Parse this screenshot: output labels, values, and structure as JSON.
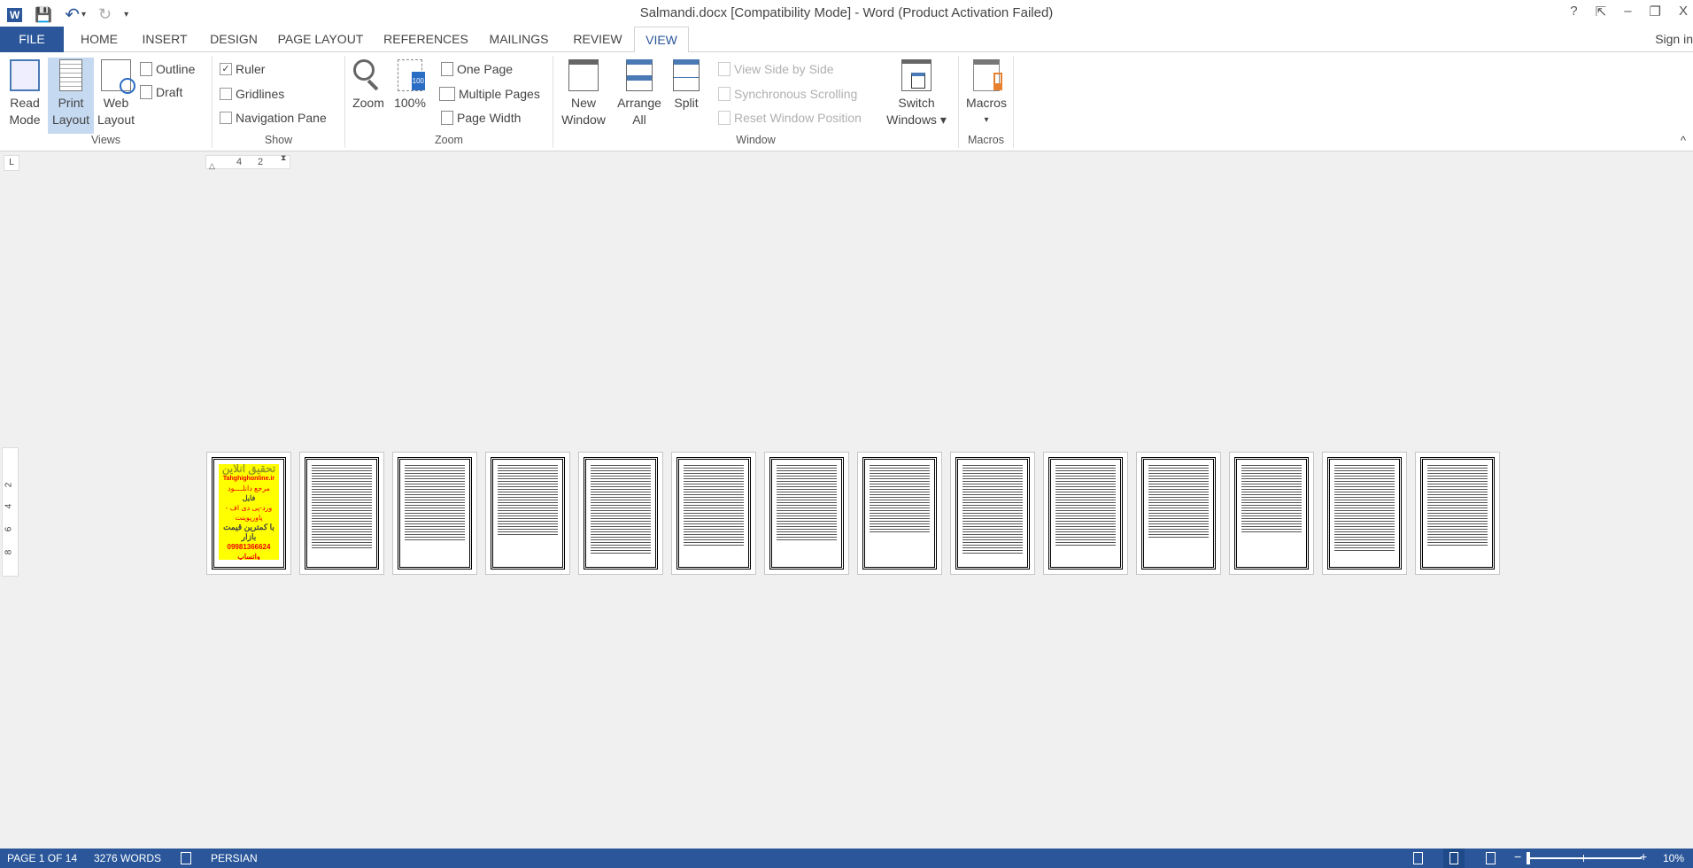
{
  "window": {
    "title": "Salmandi.docx [Compatibility Mode] - Word (Product Activation Failed)",
    "help": "?",
    "restore_ribbon": "⇱",
    "minimize": "–",
    "restore": "❐",
    "close": "X"
  },
  "qat": {
    "word": "W",
    "save": "💾",
    "undo": "↶",
    "undo_more": "▾",
    "redo": "↻",
    "customize": "▾"
  },
  "tabs": [
    "FILE",
    "HOME",
    "INSERT",
    "DESIGN",
    "PAGE LAYOUT",
    "REFERENCES",
    "MAILINGS",
    "REVIEW",
    "VIEW"
  ],
  "active_tab": "VIEW",
  "sign_in": "Sign in",
  "ribbon": {
    "views": {
      "label": "Views",
      "read_mode": [
        "Read",
        "Mode"
      ],
      "print_layout": [
        "Print",
        "Layout"
      ],
      "web_layout": [
        "Web",
        "Layout"
      ],
      "outline": "Outline",
      "draft": "Draft"
    },
    "show": {
      "label": "Show",
      "ruler": "Ruler",
      "ruler_checked": true,
      "gridlines": "Gridlines",
      "gridlines_checked": false,
      "navigation_pane": "Navigation Pane",
      "navigation_checked": false,
      "check": "✓"
    },
    "zoom": {
      "label": "Zoom",
      "zoom": "Zoom",
      "hundred": "100%",
      "hundred_badge": "100",
      "one_page": "One Page",
      "multiple_pages": "Multiple Pages",
      "page_width": "Page Width"
    },
    "window": {
      "label": "Window",
      "new_window": [
        "New",
        "Window"
      ],
      "arrange_all": [
        "Arrange",
        "All"
      ],
      "split": "Split",
      "side_by_side": "View Side by Side",
      "sync_scroll": "Synchronous Scrolling",
      "reset_position": "Reset Window Position",
      "switch_windows": [
        "Switch",
        "Windows ▾"
      ]
    },
    "macros": {
      "label": "Macros",
      "macros": "Macros",
      "arrow": "▾"
    },
    "collapse": "^"
  },
  "ruler": {
    "corner": "L",
    "marks": [
      "4",
      "2"
    ],
    "vertical": [
      "2",
      "4",
      "6",
      "8"
    ]
  },
  "cover_page": {
    "title": "تحقیق آنلاین",
    "site": "Tahghighonline.ir",
    "line1": "مرجع دانلــــود",
    "line2": "فایل",
    "line3": "ورد-پی دی اف - پاورپوینت",
    "line4": "با کمترین قیمت بازار",
    "phone": "09981366624 واتساپ"
  },
  "page_count": 14,
  "status": {
    "page": "PAGE 1 OF 14",
    "words": "3276 WORDS",
    "language": "PERSIAN",
    "zoom_minus": "−",
    "zoom_plus": "+",
    "zoom": "10%",
    "zoom_level_percent": 10
  }
}
